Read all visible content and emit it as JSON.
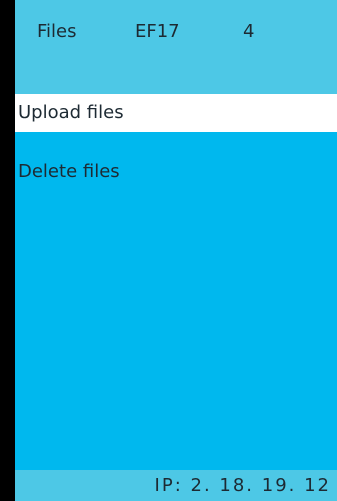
{
  "header": {
    "title": "Files",
    "code": "EF17",
    "count": "4"
  },
  "menu": {
    "items": [
      {
        "label": "Upload files",
        "selected": true
      },
      {
        "label": "Delete files",
        "selected": false
      }
    ]
  },
  "footer": {
    "ip_text": "IP: 2. 18. 19. 12"
  },
  "colors": {
    "screen_bg": "#00b8ee",
    "header_bg": "#4dc8e6",
    "selected_bg": "#ffffff",
    "text": "#1d2a33",
    "frame": "#000000"
  }
}
